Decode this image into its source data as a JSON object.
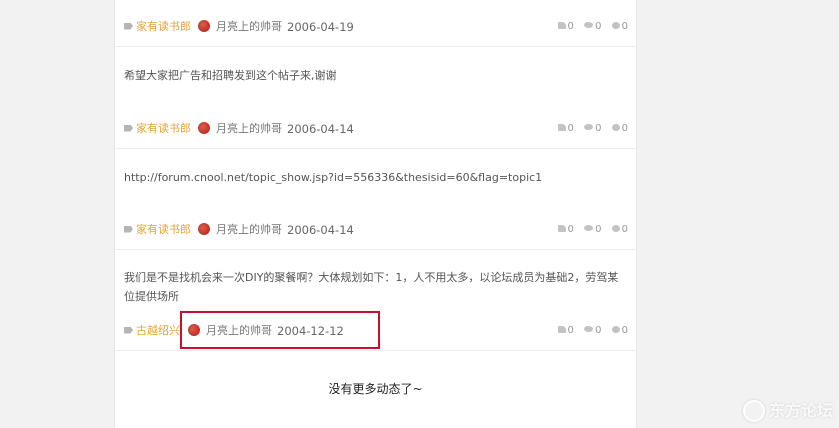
{
  "posts": [
    {
      "content": "",
      "tag": "家有读书郎",
      "author": "月亮上的帅哥",
      "date": "2006-04-19",
      "likes": "0",
      "views": "0",
      "comments": "0"
    },
    {
      "content": "希望大家把广告和招聘发到这个帖子来,谢谢",
      "tag": "家有读书郎",
      "author": "月亮上的帅哥",
      "date": "2006-04-14",
      "likes": "0",
      "views": "0",
      "comments": "0"
    },
    {
      "content": "http://forum.cnool.net/topic_show.jsp?id=556336&thesisid=60&flag=topic1",
      "tag": "家有读书郎",
      "author": "月亮上的帅哥",
      "date": "2006-04-14",
      "likes": "0",
      "views": "0",
      "comments": "0"
    },
    {
      "content": "我们是不是找机会来一次DIY的聚餐啊？大体规划如下：1，人不用太多，以论坛成员为基础2，劳驾某位提供场所",
      "tag": "古越绍兴",
      "author": "月亮上的帅哥",
      "date": "2004-12-12",
      "likes": "0",
      "views": "0",
      "comments": "0"
    }
  ],
  "footer": {
    "no_more": "没有更多动态了~"
  },
  "watermark": {
    "text": "东方论坛"
  },
  "colors": {
    "tag": "#e3a33a",
    "highlight_border": "#c8102e"
  }
}
